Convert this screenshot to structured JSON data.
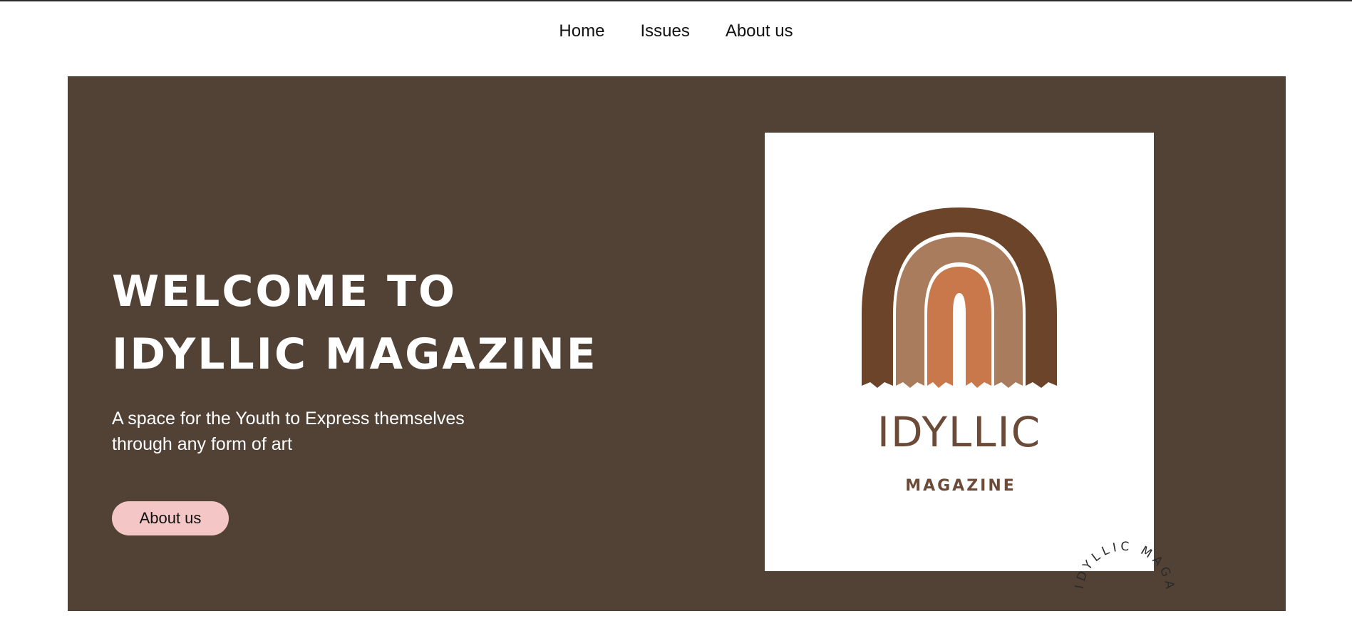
{
  "nav": {
    "items": [
      {
        "label": "Home"
      },
      {
        "label": "Issues"
      },
      {
        "label": "About us"
      }
    ]
  },
  "hero": {
    "title_line1": "WELCOME TO",
    "title_line2": "IDYLLIC MAGAZINE",
    "subtitle": "A space for the Youth to Express themselves through any form of art",
    "button_label": "About us"
  },
  "cover": {
    "logo_title": "IDYLLIC",
    "logo_subtitle": "MAGAZINE",
    "rainbow_colors": [
      "#6b4429",
      "#a97c5d",
      "#c8784a"
    ]
  },
  "badge": {
    "text": "IDYLLIC MAGAZINE"
  },
  "colors": {
    "hero_bg": "#524236",
    "button_bg": "#f4c6c6",
    "text_on_dark": "#ffffff"
  }
}
